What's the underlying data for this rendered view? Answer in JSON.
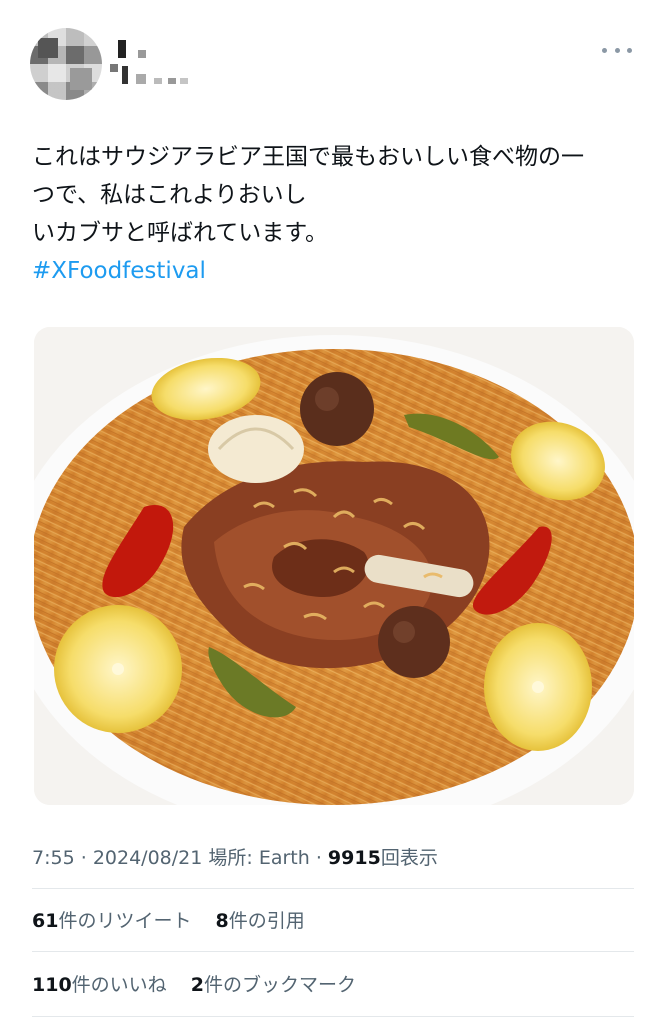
{
  "tweet": {
    "lines": [
      "これはサウジアラビア王国で最もおいしい食べ物の一",
      "つで、私はこれよりおいし",
      "いカブサと呼ばれています。"
    ],
    "hashtag": "#XFoodfestival"
  },
  "meta": {
    "time": "7:55",
    "date": "2024/08/21",
    "location_label": "場所: Earth",
    "views": "9915",
    "views_label": "回表示",
    "separator": "·"
  },
  "stats_row1": {
    "retweets_count": "61",
    "retweets_label": "件のリツイート",
    "quotes_count": "8",
    "quotes_label": "件の引用"
  },
  "stats_row2": {
    "likes_count": "110",
    "likes_label": "件のいいね",
    "bookmarks_count": "2",
    "bookmarks_label": "件のブックマーク"
  },
  "icons": {
    "more": "more-horizontal-icon"
  },
  "colors": {
    "link": "#1d9bf0",
    "secondary": "#536471",
    "primary": "#0f1419"
  }
}
